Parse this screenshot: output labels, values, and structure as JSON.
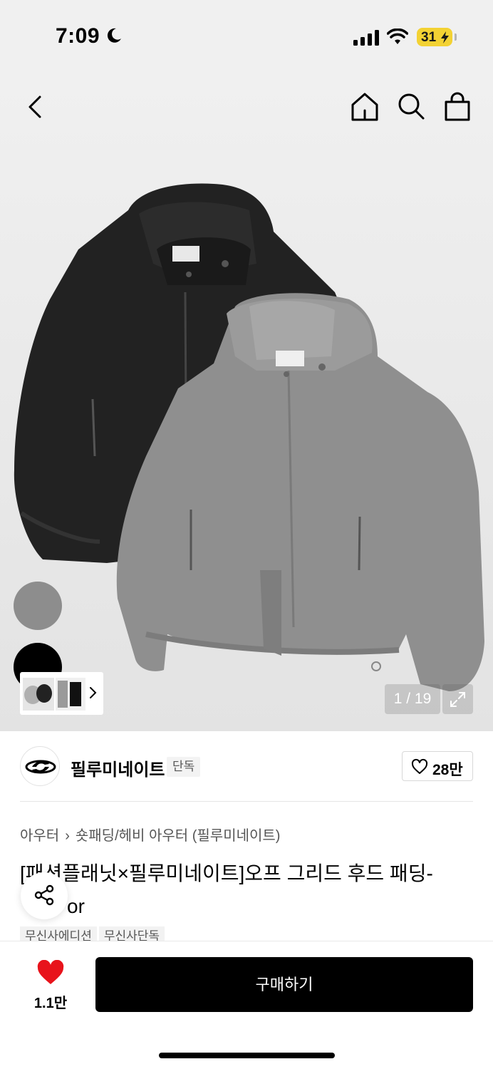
{
  "status_bar": {
    "time": "7:09",
    "battery": "31"
  },
  "nav": {
    "icons": [
      "back-icon",
      "home-icon",
      "search-icon",
      "bag-icon"
    ]
  },
  "gallery": {
    "counter": "1 / 19",
    "swatches": [
      "#8d8d8d",
      "#000000"
    ]
  },
  "brand": {
    "name": "필루미네이트",
    "badge": "단독",
    "likes": "28만"
  },
  "breadcrumb": {
    "category": "아우터",
    "subcategory": "숏패딩/헤비 아우터 (필루미네이트)"
  },
  "product": {
    "title_line1": "[패션플래닛×필루미네이트]오프 그리드 후드 패딩-",
    "title_line2": "or",
    "tags": [
      "무신사에디션",
      "무신사단독"
    ]
  },
  "bottom": {
    "fav_count": "1.1만",
    "buy_label": "구매하기"
  },
  "colors": {
    "accent": "#000000",
    "heart": "#e8131b",
    "battery": "#f3d233"
  }
}
